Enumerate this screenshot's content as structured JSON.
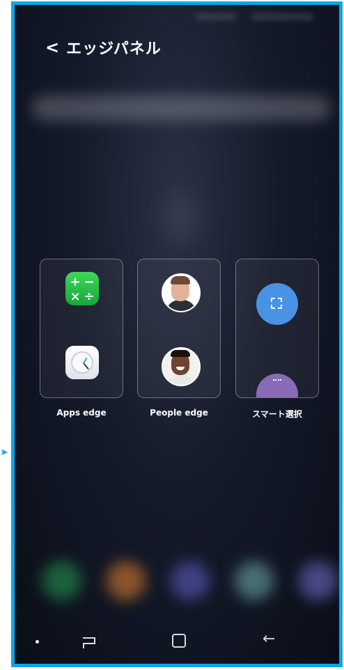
{
  "header": {
    "back_icon": "chevron-left-icon",
    "title": "エッジパネル"
  },
  "panels": [
    {
      "label": "Apps edge",
      "icons": [
        "calculator-icon",
        "clock-icon"
      ]
    },
    {
      "label": "People edge",
      "icons": [
        "contact-avatar-man-suit",
        "contact-avatar-man-smiling"
      ]
    },
    {
      "label": "スマート選択",
      "icons": [
        "rectangle-select-icon",
        "purple-tool-icon"
      ]
    }
  ],
  "navbar": {
    "items": [
      "dot-indicator",
      "recents-icon",
      "home-icon",
      "back-arrow-icon"
    ]
  },
  "colors": {
    "frame_border": "#0aa7e6",
    "background": "#151a2a",
    "select_icon": "#4a92e4",
    "calc_icon": "#17a83a"
  }
}
